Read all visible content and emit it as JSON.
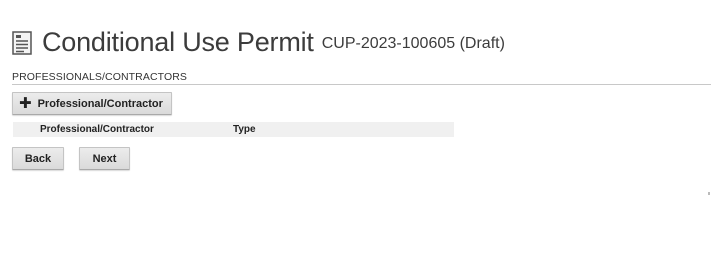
{
  "header": {
    "title": "Conditional Use Permit",
    "subtitle": "CUP-2023-100605 (Draft)",
    "icon": "document-icon"
  },
  "section": {
    "label": "PROFESSIONALS/CONTRACTORS"
  },
  "toolbar": {
    "add_label": "Professional/Contractor",
    "add_icon": "plus-icon"
  },
  "grid": {
    "columns": [
      "Professional/Contractor",
      "Type"
    ],
    "rows": []
  },
  "nav": {
    "back_label": "Back",
    "next_label": "Next"
  }
}
